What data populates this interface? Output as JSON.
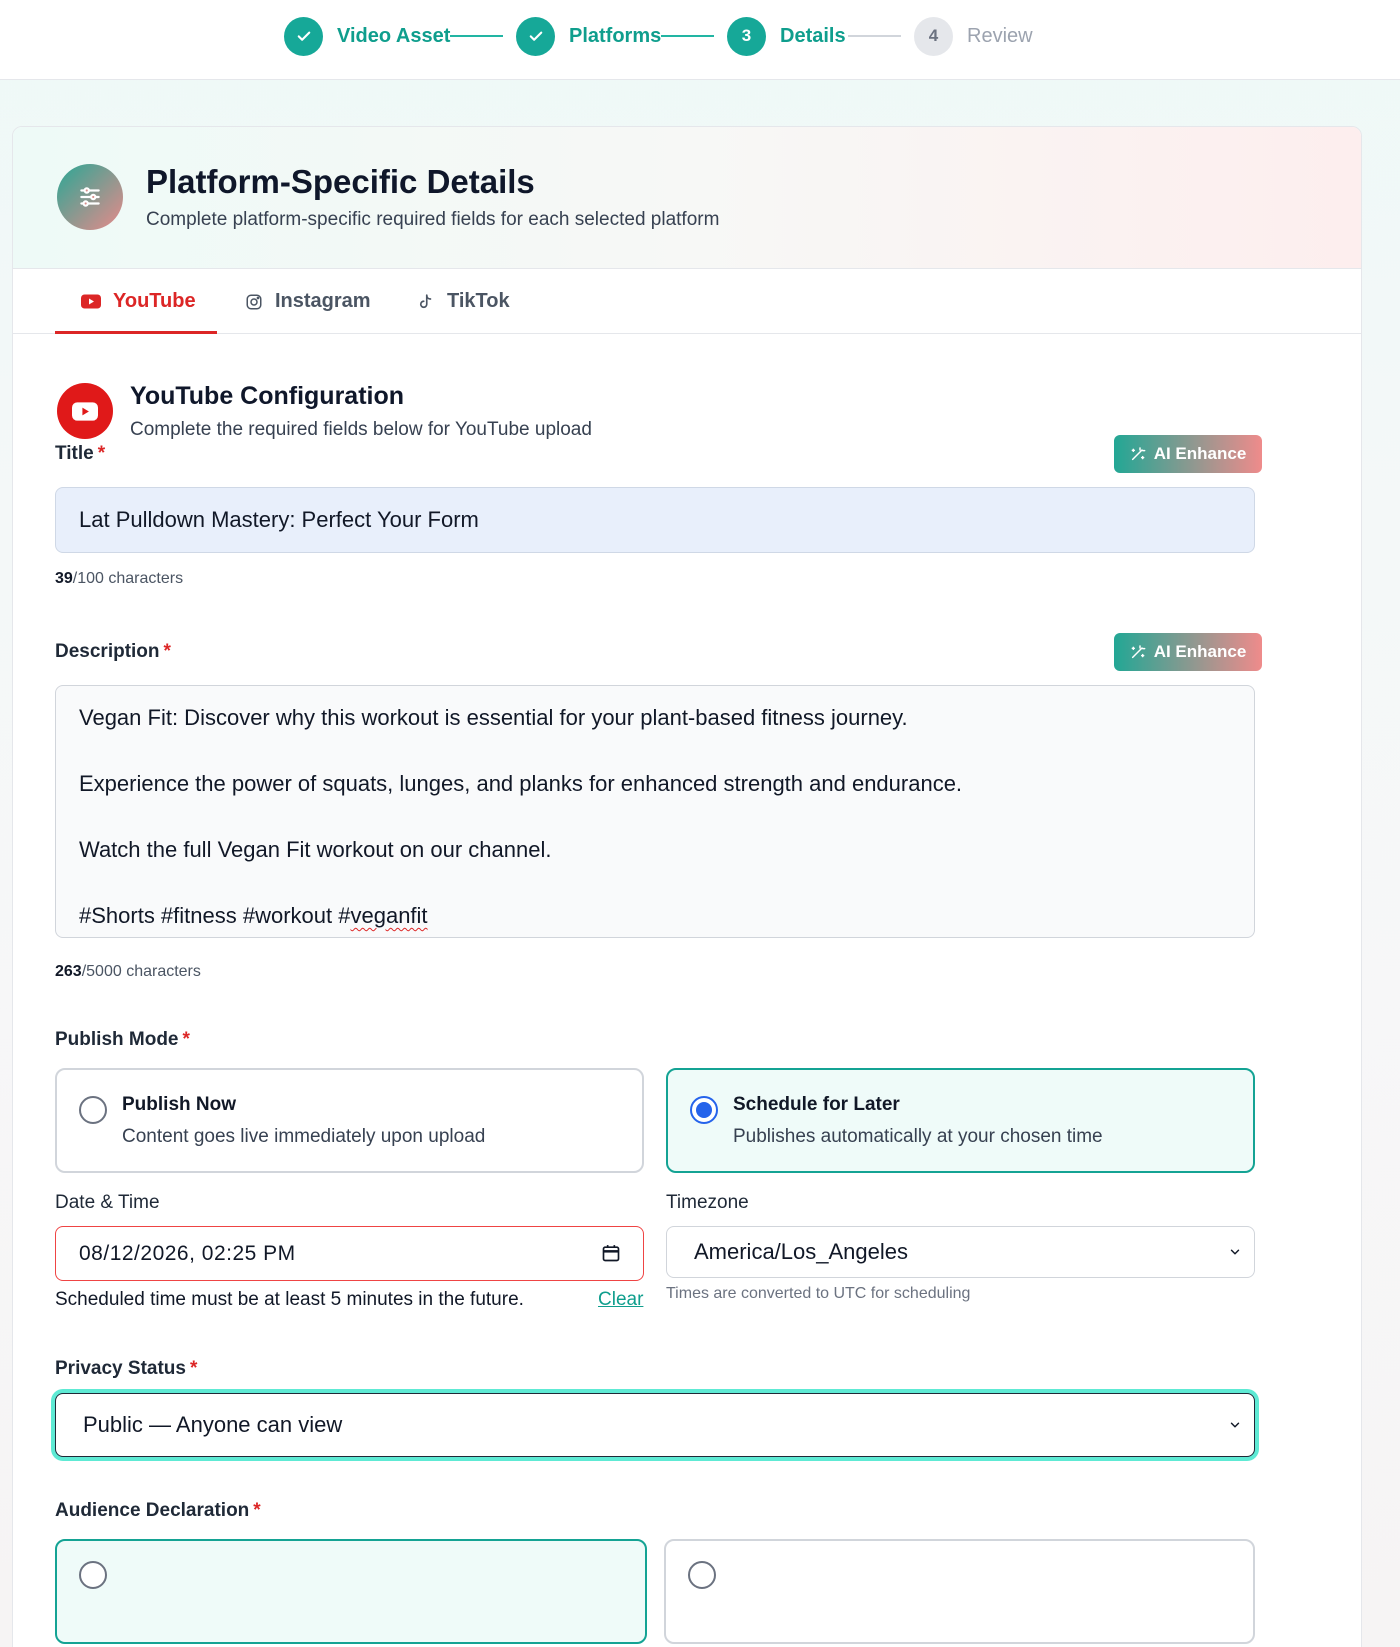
{
  "stepper": {
    "steps": [
      {
        "label": "Video Asset",
        "state": "done"
      },
      {
        "label": "Platforms",
        "state": "done"
      },
      {
        "label": "Details",
        "state": "current",
        "number": "3"
      },
      {
        "label": "Review",
        "state": "pending",
        "number": "4"
      }
    ]
  },
  "header": {
    "title": "Platform-Specific Details",
    "subtitle": "Complete platform-specific required fields for each selected platform"
  },
  "tabs": [
    {
      "label": "YouTube",
      "icon": "youtube-icon",
      "active": true
    },
    {
      "label": "Instagram",
      "icon": "instagram-icon",
      "active": false
    },
    {
      "label": "TikTok",
      "icon": "tiktok-icon",
      "active": false
    }
  ],
  "section": {
    "title": "YouTube Configuration",
    "subtitle": "Complete the required fields below for YouTube upload"
  },
  "title_field": {
    "label": "Title",
    "required": "*",
    "ai_button": "AI Enhance",
    "value": "Lat Pulldown Mastery: Perfect Your Form",
    "count": "39",
    "limit": "/100 characters"
  },
  "description_field": {
    "label": "Description",
    "required": "*",
    "ai_button": "AI Enhance",
    "lines": [
      "Vegan Fit: Discover why this workout is essential for your plant-based fitness journey.",
      "Experience the power of squats, lunges, and planks for enhanced strength and endurance.",
      "Watch the full Vegan Fit workout on our channel.",
      "#Shorts #fitness #workout #"
    ],
    "misspelled_tag": "veganfit",
    "count": "263",
    "limit": "/5000 characters"
  },
  "publish_mode": {
    "label": "Publish Mode",
    "required": "*",
    "options": [
      {
        "title": "Publish Now",
        "description": "Content goes live immediately upon upload",
        "selected": false
      },
      {
        "title": "Schedule for Later",
        "description": "Publishes automatically at your chosen time",
        "selected": true
      }
    ]
  },
  "schedule": {
    "date_label": "Date & Time",
    "date_value": "08/12/2026, 02:25 PM",
    "error": "Scheduled time must be at least 5 minutes in the future.",
    "clear_link": "Clear",
    "timezone_label": "Timezone",
    "timezone_value": "America/Los_Angeles",
    "timezone_hint": "Times are converted to UTC for scheduling"
  },
  "privacy": {
    "label": "Privacy Status",
    "required": "*",
    "value": "Public — Anyone can view"
  },
  "audience": {
    "label": "Audience Declaration",
    "required": "*"
  },
  "colors": {
    "accent": "#14a394",
    "youtube_red": "#e01919",
    "error_border": "#ef4444",
    "focus_ring": "#5eead4"
  }
}
